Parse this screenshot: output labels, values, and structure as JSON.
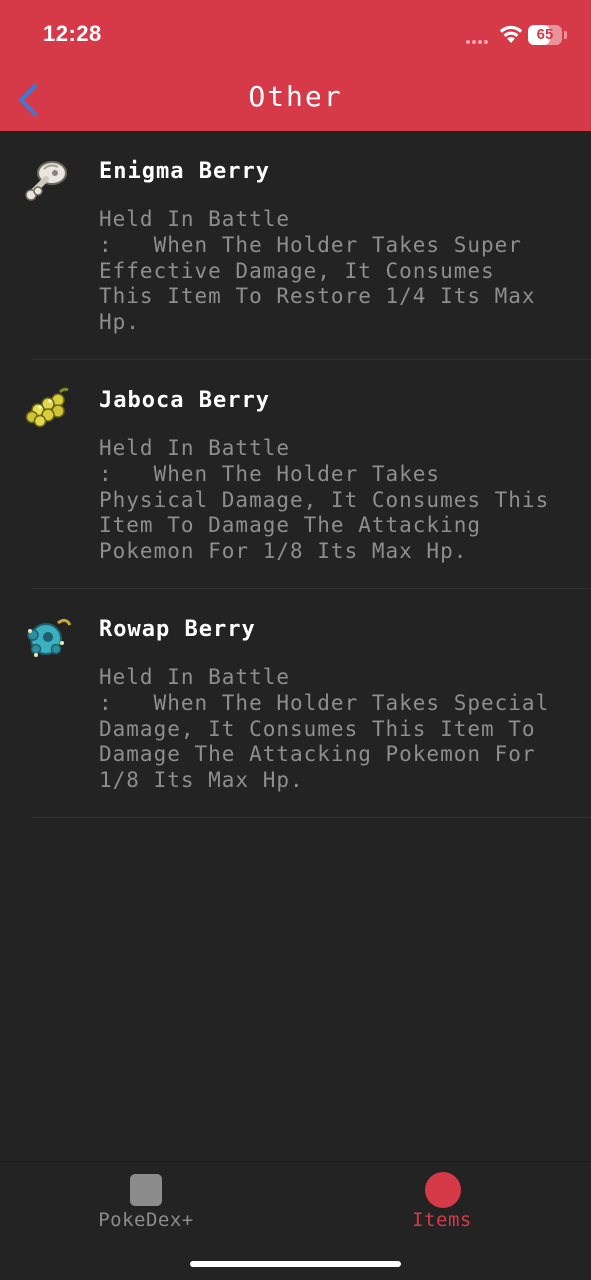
{
  "status_bar": {
    "time": "12:28",
    "battery_level": "65",
    "battery_fraction": 0.65
  },
  "nav": {
    "title": "Other",
    "back_icon": "chevron-left-icon"
  },
  "colors": {
    "header": "#d63a48",
    "background": "#232323",
    "accent": "#d63a48",
    "back_icon": "#3a7bd5",
    "description_text": "#8e8e8e",
    "inactive_tab": "#8c8c8c"
  },
  "items": [
    {
      "name": "Enigma Berry",
      "icon": "enigma-berry-icon",
      "description_lines": [
        "Held In Battle",
        ":   When The Holder Takes Super",
        "Effective Damage, It Consumes",
        "This Item To Restore 1/4 Its Max",
        "Hp."
      ]
    },
    {
      "name": "Jaboca Berry",
      "icon": "jaboca-berry-icon",
      "description_lines": [
        "Held In Battle",
        ":   When The Holder Takes",
        "Physical Damage, It Consumes This",
        "Item To Damage The Attacking",
        "Pokemon For 1/8 Its Max Hp."
      ]
    },
    {
      "name": "Rowap Berry",
      "icon": "rowap-berry-icon",
      "description_lines": [
        "Held In Battle",
        ":   When The Holder Takes Special",
        "Damage, It Consumes This Item To",
        "Damage The Attacking Pokemon For",
        "1/8 Its Max Hp."
      ]
    }
  ],
  "tabs": [
    {
      "label": "PokeDex+",
      "icon": "square-icon",
      "active": false
    },
    {
      "label": "Items",
      "icon": "circle-icon",
      "active": true
    }
  ]
}
